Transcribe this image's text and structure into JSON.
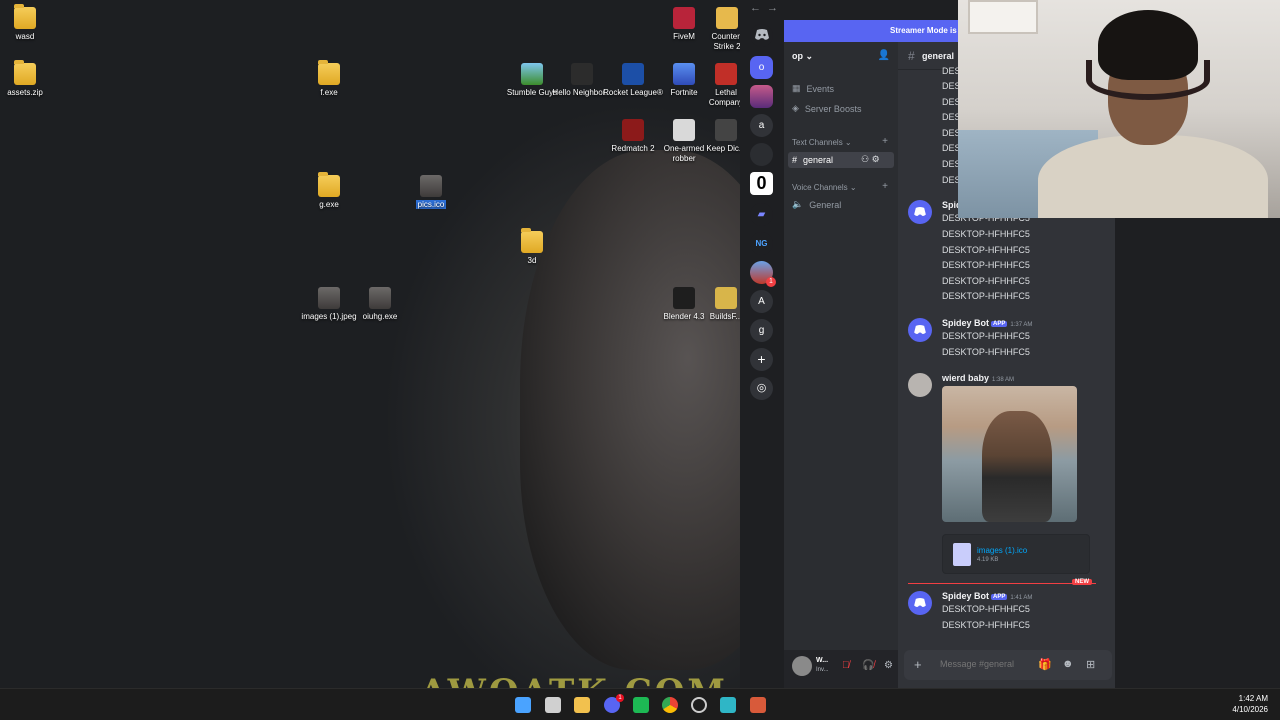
{
  "desktop": {
    "icons": [
      {
        "label": "wasd",
        "kind": "folder"
      },
      {
        "label": "assets.zip",
        "kind": "folder"
      },
      {
        "label": "f.exe",
        "kind": "folder"
      },
      {
        "label": "g.exe",
        "kind": "folder"
      },
      {
        "label": "pics.ico",
        "kind": "photo"
      },
      {
        "label": "3d",
        "kind": "folder"
      },
      {
        "label": "images (1).jpeg",
        "kind": "photo"
      },
      {
        "label": "oiuhg.exe",
        "kind": "photo"
      },
      {
        "label": "FiveM",
        "kind": "app"
      },
      {
        "label": "Counter-Strike 2",
        "kind": "app"
      },
      {
        "label": "Stumble Guys",
        "kind": "app"
      },
      {
        "label": "Hello Neighbor...",
        "kind": "app"
      },
      {
        "label": "Rocket League®",
        "kind": "app"
      },
      {
        "label": "Fortnite",
        "kind": "app"
      },
      {
        "label": "Lethal Company",
        "kind": "app"
      },
      {
        "label": "Redmatch 2",
        "kind": "app"
      },
      {
        "label": "One-armed robber",
        "kind": "app"
      },
      {
        "label": "Keep Dic...",
        "kind": "app"
      },
      {
        "label": "Blender 4.3",
        "kind": "app"
      },
      {
        "label": "BuildsF...",
        "kind": "app"
      }
    ],
    "wallpaper_text": "AWOATK.COM"
  },
  "discord": {
    "streamer_banner": "Streamer Mode is e",
    "server_name": "op",
    "guilds": [
      "o",
      "a",
      "0",
      "A",
      "g"
    ],
    "guild_badge": "1",
    "channels": {
      "events": "Events",
      "boosts": "Server Boosts",
      "text_category": "Text Channels",
      "text_channel": "general",
      "voice_category": "Voice Channels",
      "voice_channel": "General"
    },
    "chat": {
      "header_channel": "general",
      "truncated_lines": [
        "DES",
        "DES",
        "DES",
        "DES",
        "DES",
        "DES",
        "DES",
        "DES"
      ],
      "messages": [
        {
          "author": "Spid",
          "lines": [
            "DESKTOP-HFHHFC5",
            "DESKTOP-HFHHFC5",
            "DESKTOP-HFHHFC5",
            "DESKTOP-HFHHFC5",
            "DESKTOP-HFHHFC5",
            "DESKTOP-HFHHFC5"
          ]
        },
        {
          "author": "Spidey Bot",
          "tag": "APP",
          "time": "1:37 AM",
          "lines": [
            "DESKTOP-HFHHFC5",
            "DESKTOP-HFHHFC5"
          ]
        },
        {
          "author": "wierd baby",
          "time": "1:38 AM",
          "attachment_name": "images (1).ico",
          "attachment_size": "4.19 KB"
        },
        {
          "author": "Spidey Bot",
          "tag": "APP",
          "time": "1:41 AM",
          "lines": [
            "DESKTOP-HFHHFC5",
            "DESKTOP-HFHHFC5"
          ]
        }
      ],
      "new_label": "NEW"
    },
    "composer_placeholder": "Message #general",
    "user": {
      "name": "W...",
      "status": "Inv..."
    }
  },
  "taskbar": {
    "time": "1:42 AM",
    "date": "4/10/2026",
    "discord_badge": "1"
  },
  "colors": {
    "discord_blurple": "#5865f2",
    "discord_bg": "#313338",
    "mention_red": "#f23f43",
    "selection_blue": "#2d6fd6"
  }
}
